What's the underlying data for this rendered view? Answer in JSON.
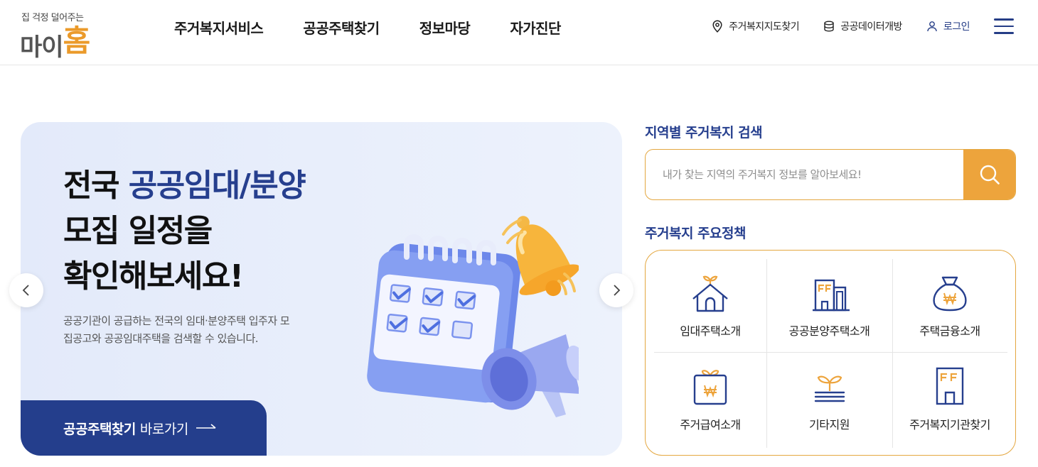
{
  "header": {
    "logo_tagline": "집 걱정 덜어주는",
    "logo_main": "마이",
    "logo_home": "홈",
    "nav": [
      "주거복지서비스",
      "공공주택찾기",
      "정보마당",
      "자가진단"
    ],
    "util": {
      "map": "주거복지지도찾기",
      "data": "공공데이터개방",
      "login": "로그인"
    }
  },
  "hero": {
    "title_line1_plain": "전국 ",
    "title_line1_accent": "공공임대/분양",
    "title_line2": "모집 일정을",
    "title_line3": "확인해보세요!",
    "description": "공공기관이 공급하는 전국의 임대·분양주택 입주자 모집공고와 공공임대주택을 검색할 수 있습니다.",
    "button_bold": "공공주택찾기",
    "button_rest": "바로가기"
  },
  "search": {
    "title": "지역별 주거복지 검색",
    "placeholder": "내가 찾는 지역의 주거복지 정보를 알아보세요!"
  },
  "policy": {
    "title": "주거복지 주요정책",
    "items": [
      {
        "label": "임대주택소개",
        "icon": "house-sprout-icon"
      },
      {
        "label": "공공분양주택소개",
        "icon": "building-icon"
      },
      {
        "label": "주택금융소개",
        "icon": "money-bag-icon"
      },
      {
        "label": "주거급여소개",
        "icon": "gift-won-icon"
      },
      {
        "label": "기타지원",
        "icon": "sprout-support-icon"
      },
      {
        "label": "주거복지기관찾기",
        "icon": "tower-building-icon"
      }
    ]
  },
  "colors": {
    "navy": "#263f8e",
    "orange": "#eda43c",
    "hero_bg": "#e9effb"
  }
}
